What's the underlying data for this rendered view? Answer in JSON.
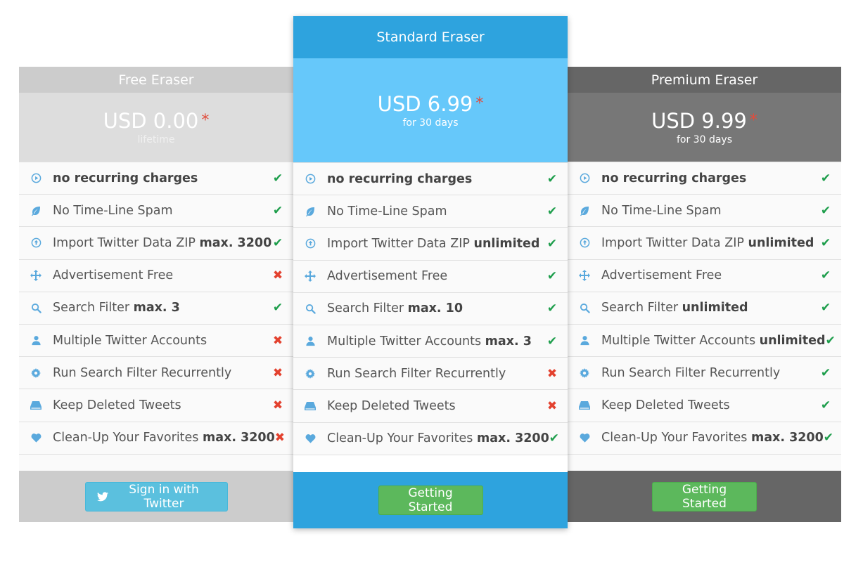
{
  "plans": [
    {
      "id": "free",
      "title": "Free Eraser",
      "price": "USD 0.00",
      "asterisk": "*",
      "period": "lifetime",
      "button_label": "Sign in with Twitter",
      "features": [
        {
          "icon": "play-circle-icon",
          "text": "no recurring charges",
          "bold": "",
          "status": "check"
        },
        {
          "icon": "leaf-icon",
          "text": "No Time-Line Spam",
          "bold": "",
          "status": "check"
        },
        {
          "icon": "upload-circle-icon",
          "text": "Import Twitter Data ZIP ",
          "bold": "max. 3200",
          "status": "check"
        },
        {
          "icon": "move-arrows-icon",
          "text": "Advertisement Free",
          "bold": "",
          "status": "cross"
        },
        {
          "icon": "search-icon",
          "text": "Search Filter ",
          "bold": "max. 3",
          "status": "check"
        },
        {
          "icon": "user-icon",
          "text": "Multiple Twitter Accounts",
          "bold": "",
          "status": "cross"
        },
        {
          "icon": "gear-icon",
          "text": "Run Search Filter Recurrently",
          "bold": "",
          "status": "cross"
        },
        {
          "icon": "hdd-icon",
          "text": "Keep Deleted Tweets",
          "bold": "",
          "status": "cross"
        },
        {
          "icon": "heart-icon",
          "text": "Clean-Up Your Favorites ",
          "bold": "max. 3200",
          "status": "cross"
        }
      ]
    },
    {
      "id": "standard",
      "title": "Standard Eraser",
      "price": "USD 6.99",
      "asterisk": "*",
      "period": "for 30 days",
      "button_label": "Getting Started",
      "features": [
        {
          "icon": "play-circle-icon",
          "text": "no recurring charges",
          "bold": "",
          "status": "check"
        },
        {
          "icon": "leaf-icon",
          "text": "No Time-Line Spam",
          "bold": "",
          "status": "check"
        },
        {
          "icon": "upload-circle-icon",
          "text": "Import Twitter Data ZIP ",
          "bold": "unlimited",
          "status": "check"
        },
        {
          "icon": "move-arrows-icon",
          "text": "Advertisement Free",
          "bold": "",
          "status": "check"
        },
        {
          "icon": "search-icon",
          "text": "Search Filter ",
          "bold": "max. 10",
          "status": "check"
        },
        {
          "icon": "user-icon",
          "text": "Multiple Twitter Accounts ",
          "bold": "max. 3",
          "status": "check"
        },
        {
          "icon": "gear-icon",
          "text": "Run Search Filter Recurrently",
          "bold": "",
          "status": "cross"
        },
        {
          "icon": "hdd-icon",
          "text": "Keep Deleted Tweets",
          "bold": "",
          "status": "cross"
        },
        {
          "icon": "heart-icon",
          "text": "Clean-Up Your Favorites ",
          "bold": "max. 3200",
          "status": "check"
        }
      ]
    },
    {
      "id": "premium",
      "title": "Premium Eraser",
      "price": "USD 9.99",
      "asterisk": "*",
      "period": "for 30 days",
      "button_label": "Getting Started",
      "features": [
        {
          "icon": "play-circle-icon",
          "text": "no recurring charges",
          "bold": "",
          "status": "check"
        },
        {
          "icon": "leaf-icon",
          "text": "No Time-Line Spam",
          "bold": "",
          "status": "check"
        },
        {
          "icon": "upload-circle-icon",
          "text": "Import Twitter Data ZIP ",
          "bold": "unlimited",
          "status": "check"
        },
        {
          "icon": "move-arrows-icon",
          "text": "Advertisement Free",
          "bold": "",
          "status": "check"
        },
        {
          "icon": "search-icon",
          "text": "Search Filter ",
          "bold": "unlimited",
          "status": "check"
        },
        {
          "icon": "user-icon",
          "text": "Multiple Twitter Accounts ",
          "bold": "unlimited",
          "status": "check"
        },
        {
          "icon": "gear-icon",
          "text": "Run Search Filter Recurrently",
          "bold": "",
          "status": "check"
        },
        {
          "icon": "hdd-icon",
          "text": "Keep Deleted Tweets",
          "bold": "",
          "status": "check"
        },
        {
          "icon": "heart-icon",
          "text": "Clean-Up Your Favorites ",
          "bold": "max. 3200",
          "status": "check"
        }
      ]
    }
  ],
  "colors": {
    "check": "#1e9e4c",
    "cross": "#e3412e",
    "icon": "#5aa9dd",
    "standard_header": "#2ea3de",
    "standard_price": "#66c8fa",
    "free_header": "#cccccc",
    "premium_header": "#666666",
    "twitter_button": "#5bc0de",
    "green_button": "#5cb85c"
  }
}
